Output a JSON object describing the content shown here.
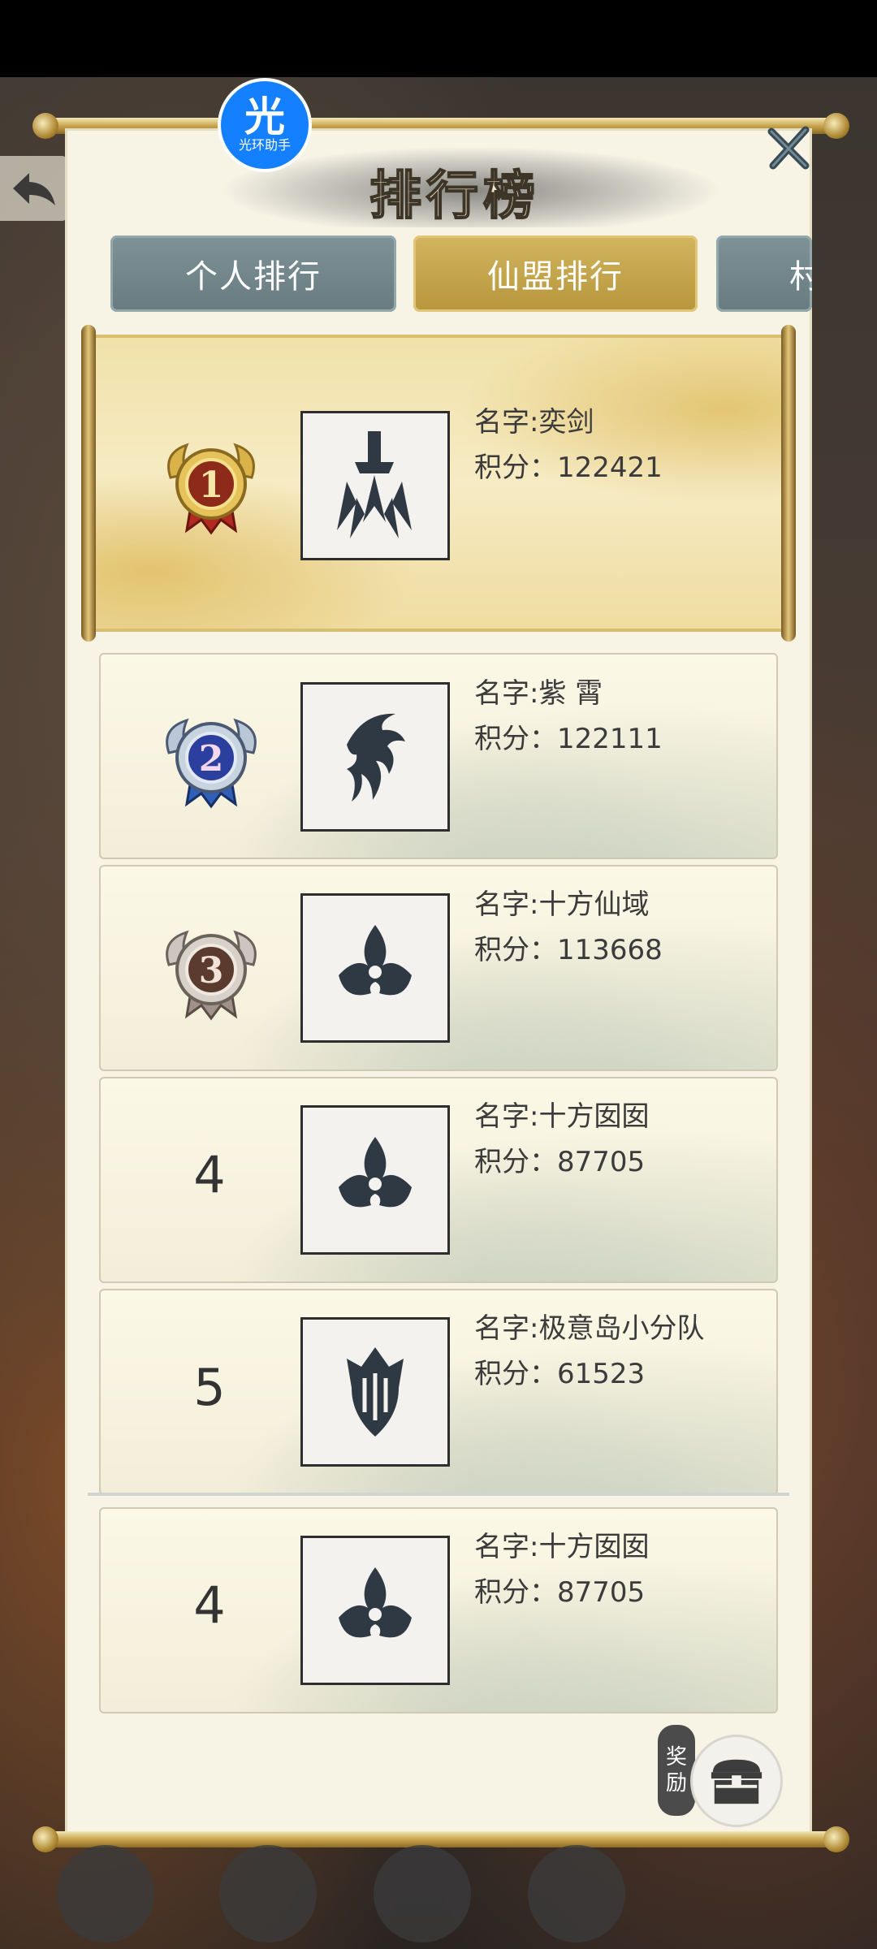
{
  "header": {
    "title": "排行榜",
    "logo_big": "光",
    "logo_small": "光环助手",
    "close_icon": "close-icon",
    "back_icon": "back-arrow-icon"
  },
  "tabs": [
    {
      "label": "个人排行",
      "active": false
    },
    {
      "label": "仙盟排行",
      "active": true
    },
    {
      "label": "村",
      "active": false
    }
  ],
  "rows": [
    {
      "rank": "1",
      "medal": "gold-medal",
      "emblem": "sword-emblem",
      "name": "名字:奕剑",
      "score": "积分：122421"
    },
    {
      "rank": "2",
      "medal": "blue-medal",
      "emblem": "dragon-emblem",
      "name": "名字:紫  霄",
      "score": "积分：122111"
    },
    {
      "rank": "3",
      "medal": "bronze-medal",
      "emblem": "trefoil-emblem",
      "name": "名字:十方仙域",
      "score": "积分：113668"
    },
    {
      "rank": "4",
      "medal": null,
      "emblem": "trefoil-emblem",
      "name": "名字:十方囡囡",
      "score": "积分：87705"
    },
    {
      "rank": "5",
      "medal": null,
      "emblem": "crest-emblem",
      "name": "名字:极意岛小分队",
      "score": "积分：61523"
    }
  ],
  "my_row": {
    "rank": "4",
    "emblem": "trefoil-emblem",
    "name": "名字:十方囡囡",
    "score": "积分：87705"
  },
  "reward": {
    "label_top": "奖",
    "label_bottom": "励",
    "icon": "treasure-chest-icon"
  },
  "colors": {
    "tab_inactive": "#748a8e",
    "tab_active": "#c4a54c",
    "panel": "#f7f4e6",
    "gold_scroll": "#f0e0a8"
  }
}
